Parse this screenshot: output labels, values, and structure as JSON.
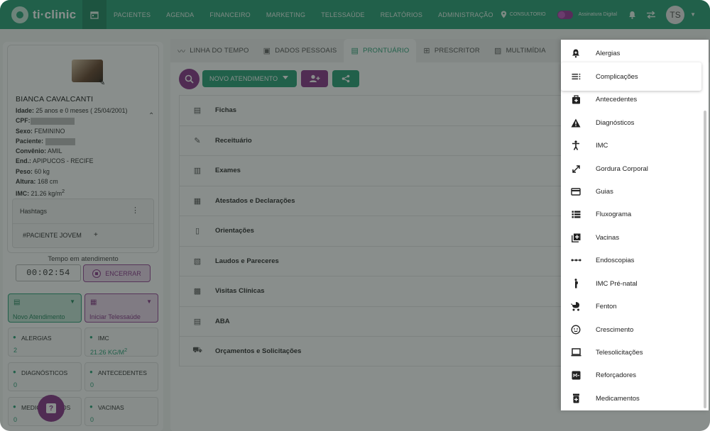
{
  "app": {
    "logo_text": "ti·clinic",
    "accent": "#2fa37b",
    "purple": "#8d3a8d"
  },
  "nav": {
    "items": [
      "PACIENTES",
      "AGENDA",
      "FINANCEIRO",
      "MARKETING",
      "TELESSAÚDE",
      "RELATÓRIOS",
      "ADMINISTRAÇÃO"
    ],
    "location": "CONSULTORIO",
    "signature": "Assinatura Digital",
    "avatar_initials": "TS"
  },
  "patient": {
    "name": "BIANCA CAVALCANTI",
    "idade_label": "Idade:",
    "idade": "25 anos e 0 meses ( 25/04/2001)",
    "cpf_label": "CPF:",
    "sexo_label": "Sexo:",
    "sexo": "FEMININO",
    "paciente_label": "Paciente:",
    "convenio_label": "Convênio:",
    "convenio": "AMIL",
    "end_label": "End.:",
    "end": "APIPUCOS - RECIFE",
    "peso_label": "Peso:",
    "peso": "60 kg",
    "altura_label": "Altura:",
    "altura": "168 cm",
    "imc_label": "IMC:",
    "imc": "21.26 kg/m",
    "imc_sup": "2"
  },
  "hashtags": {
    "title": "Hashtags",
    "tag": "#PACIENTE JOVEM",
    "add": "+"
  },
  "timer": {
    "label": "Tempo em atendimento",
    "value": "00:02:54",
    "stop_label": "ENCERRAR"
  },
  "actions": {
    "novo": "Novo Atendimento",
    "tele": "Iniciar Telessaúde"
  },
  "tiles": [
    {
      "label": "ALERGIAS",
      "value": "2"
    },
    {
      "label": "IMC",
      "value": "21.26 KG/M",
      "sup": "2"
    },
    {
      "label": "DIAGNÓSTICOS",
      "value": "0"
    },
    {
      "label": "ANTECEDENTES",
      "value": "0"
    },
    {
      "label": "MEDICAMENTOS",
      "value": "0"
    },
    {
      "label": "VACINAS",
      "value": "0"
    }
  ],
  "tabs": [
    "LINHA DO TEMPO",
    "DADOS PESSOAIS",
    "PRONTUÁRIO",
    "PRESCRITOR",
    "MULTIMÍDIA"
  ],
  "toolbar": {
    "novo_label": "NOVO ATENDIMENTO"
  },
  "sections": [
    "Fichas",
    "Receituário",
    "Exames",
    "Atestados e Declarações",
    "Orientações",
    "Laudos e Pareceres",
    "Visitas Clínicas",
    "ABA",
    "Orçamentos e Solicitações"
  ],
  "menu": {
    "items": [
      "Alergias",
      "Complicações",
      "Antecedentes",
      "Diagnósticos",
      "IMC",
      "Gordura Corporal",
      "Guias",
      "Fluxograma",
      "Vacinas",
      "Endoscopias",
      "IMC Pré-natal",
      "Fenton",
      "Crescimento",
      "Telesolicitações",
      "Reforçadores",
      "Medicamentos"
    ],
    "icons": [
      "bell-plus-icon",
      "list-icon",
      "medical-bag-icon",
      "warning-icon",
      "person-icon",
      "resize-icon",
      "card-icon",
      "list-bulleted-icon",
      "plus-box-icon",
      "dots-line-icon",
      "pregnant-icon",
      "stroller-icon",
      "face-icon",
      "laptop-icon",
      "reinforcer-icon",
      "pill-icon"
    ],
    "highlighted": "Complicações"
  }
}
